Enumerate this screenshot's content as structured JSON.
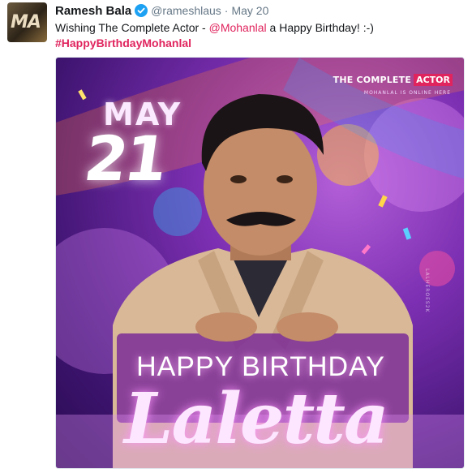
{
  "tweet": {
    "avatar_text": "MA",
    "author_name": "Ramesh Bala",
    "verified_icon": "verified-badge-icon",
    "handle": "@rameshlaus",
    "separator": "·",
    "date": "May 20",
    "text_before": "Wishing The Complete Actor - ",
    "mention": "@Mohanlal",
    "text_after": " a Happy Birthday! :-)",
    "hashtag": "#HappyBirthdayMohanlal"
  },
  "media": {
    "logo_main": "THE COMPLETE",
    "logo_accent": "ACTOR",
    "logo_sub": "MOHANLAL IS ONLINE HERE",
    "month": "MAY",
    "day": "21",
    "greeting": "HAPPY BIRTHDAY",
    "name": "Laletta",
    "watermark": "LALHEROES2K"
  },
  "colors": {
    "accent": "#e0245e",
    "verified": "#1da1f2",
    "text": "#14171a",
    "muted": "#657786"
  }
}
